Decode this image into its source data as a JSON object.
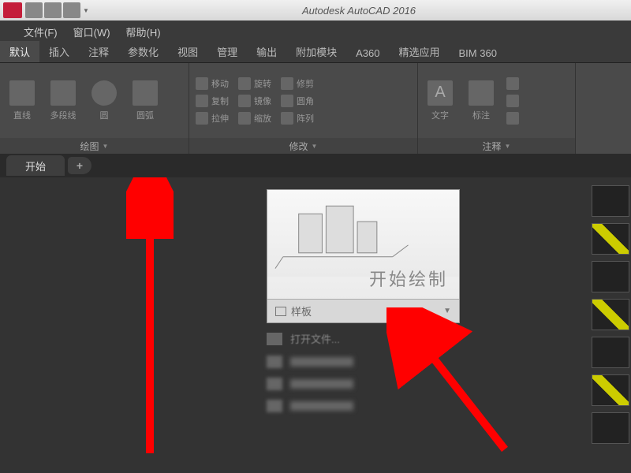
{
  "title": "Autodesk AutoCAD 2016",
  "menu": {
    "file": "文件(F)",
    "window": "窗口(W)",
    "help": "帮助(H)"
  },
  "tabs": {
    "default": "默认",
    "insert": "插入",
    "annotate": "注释",
    "param": "参数化",
    "view": "视图",
    "manage": "管理",
    "output": "输出",
    "addon": "附加模块",
    "a360": "A360",
    "featured": "精选应用",
    "bim360": "BIM 360"
  },
  "panels": {
    "draw": {
      "title": "绘图",
      "line": "直线",
      "polyline": "多段线",
      "circle": "圆",
      "arc": "圆弧"
    },
    "modify": {
      "title": "修改",
      "move": "移动",
      "rotate": "旋转",
      "trim": "修剪",
      "copy": "复制",
      "mirror": "镜像",
      "fillet": "圆角",
      "stretch": "拉伸",
      "scale": "缩放",
      "array": "阵列"
    },
    "annotation": {
      "title": "注释",
      "text": "文字",
      "dim": "标注"
    }
  },
  "doc_tab": "开始",
  "start": {
    "title": "开始绘制",
    "template": "样板",
    "open_file": "打开文件..."
  }
}
